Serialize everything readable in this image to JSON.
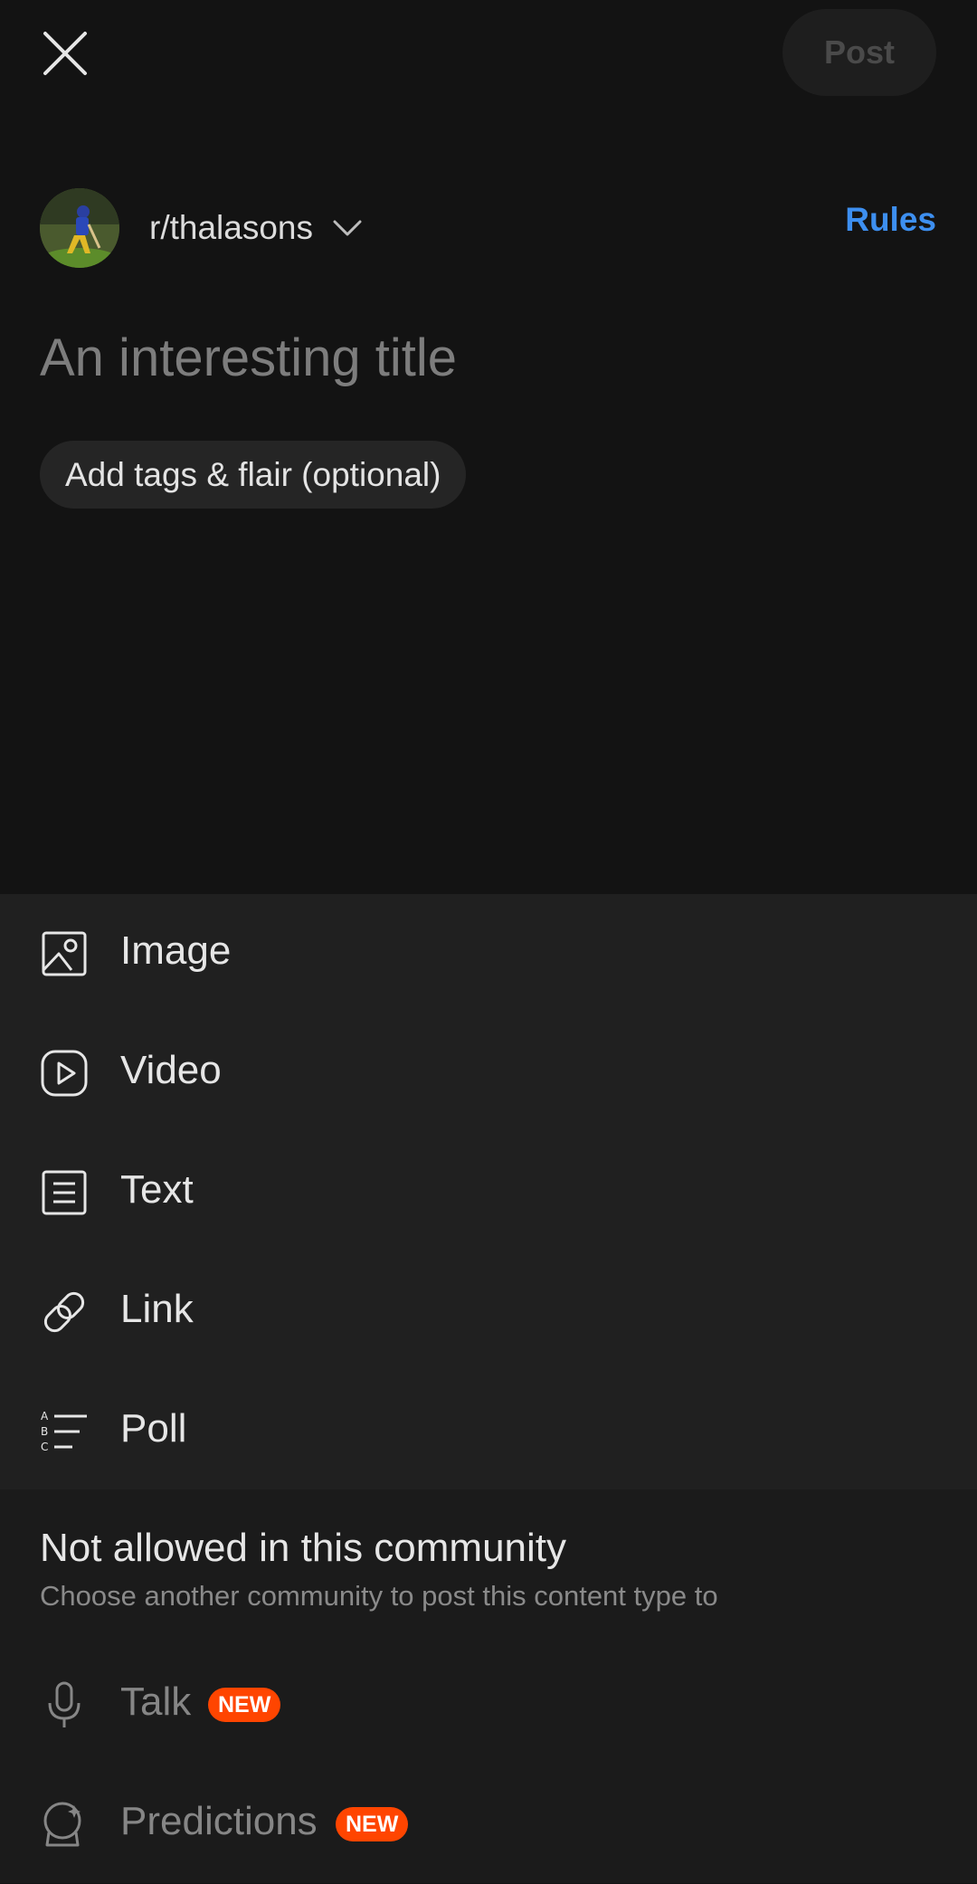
{
  "header": {
    "post_label": "Post"
  },
  "community": {
    "name": "r/thalasons",
    "rules_label": "Rules"
  },
  "title_field": {
    "placeholder": "An interesting title",
    "value": ""
  },
  "tags": {
    "label": "Add tags & flair (optional)"
  },
  "post_types": [
    {
      "label": "Image",
      "icon": "image-icon"
    },
    {
      "label": "Video",
      "icon": "video-icon"
    },
    {
      "label": "Text",
      "icon": "text-icon"
    },
    {
      "label": "Link",
      "icon": "link-icon"
    },
    {
      "label": "Poll",
      "icon": "poll-icon"
    }
  ],
  "not_allowed": {
    "title": "Not allowed in this community",
    "subtitle": "Choose another community to post this content type to",
    "items": [
      {
        "label": "Talk",
        "badge": "NEW",
        "icon": "microphone-icon"
      },
      {
        "label": "Predictions",
        "badge": "NEW",
        "icon": "crystal-ball-icon"
      }
    ]
  },
  "colors": {
    "accent_blue": "#3d8ff0",
    "badge_orange": "#ff4500",
    "background": "#131313",
    "sheet": "#202020"
  }
}
